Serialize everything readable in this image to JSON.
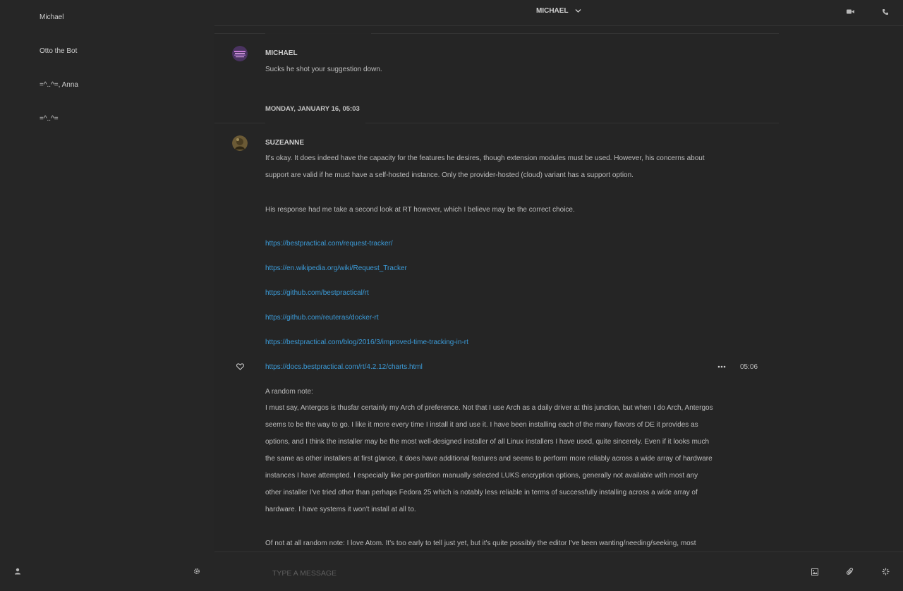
{
  "sidebar": {
    "rooms": [
      {
        "name": "Michael"
      },
      {
        "name": "Otto the Bot"
      },
      {
        "name": "=^..^=, Anna"
      },
      {
        "name": "=^..^="
      }
    ],
    "footer_icons": [
      "user-icon",
      "gear-icon"
    ]
  },
  "header": {
    "room_name": "MICHAEL",
    "icons": [
      "video-icon",
      "phone-icon"
    ]
  },
  "timeline": {
    "messages": [
      {
        "sender": "MICHAEL",
        "text": "Sucks he shot your suggestion down."
      }
    ],
    "date_separator": "MONDAY, JANUARY 16, 05:03",
    "suzeanne": {
      "sender": "SUZEANNE",
      "para1": "It's okay. It does indeed have the capacity for the features he desires, though extension modules must be used. However, his concerns about support are valid if he must have a self-hosted instance. Only the provider-hosted (cloud) variant has a support option.",
      "para2": "His response had me take a second look at RT however, which I believe may be the correct choice.",
      "links": [
        "https://bestpractical.com/request-tracker/",
        "https://en.wikipedia.org/wiki/Request_Tracker",
        "https://github.com/bestpractical/rt",
        "https://github.com/reuteras/docker-rt",
        "https://bestpractical.com/blog/2016/3/improved-time-tracking-in-rt",
        "https://docs.bestpractical.com/rt/4.2.12/charts.html"
      ],
      "timestamp": "05:06",
      "note_heading": "A random note:",
      "para3": "I must say, Antergos is thusfar certainly my Arch of preference. Not that I use Arch as a daily driver at this junction, but when I do Arch, Antergos seems to be the way to go. I like it more every time I install it and use it. I have been installing each of the many flavors of DE it provides as options, and I think the installer may be the most well-designed installer of all Linux installers I have used, quite sincerely. Even if it looks much the same as other installers at first glance, it does have additional features and seems to perform more reliably across a wide array of hardware instances I have attempted. I especially like per-partition manually selected LUKS encryption options, generally not available with most any other installer I've tried other than perhaps Fedora 25 which is notably less reliable in terms of successfully installing across a wide array of hardware. I have systems it won't install at all to.",
      "para4": "Of not at all random note: I love Atom. It's too early to tell just yet, but it's quite possibly the editor I've been wanting/needing/seeking, most"
    }
  },
  "composer": {
    "placeholder": "TYPE A MESSAGE",
    "icons": [
      "image-icon",
      "paperclip-icon",
      "emoji-icon"
    ]
  },
  "colors": {
    "background": "#252525",
    "link": "#3b9bd8",
    "text": "#bdbdbd"
  }
}
